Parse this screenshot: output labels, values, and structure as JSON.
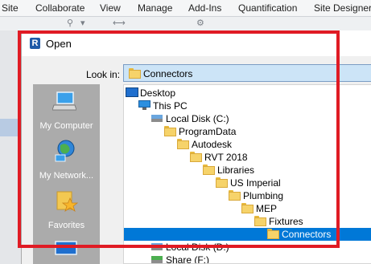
{
  "menubar": {
    "items": [
      "Site",
      "Collaborate",
      "View",
      "Manage",
      "Add-Ins",
      "Quantification",
      "Site Designer"
    ]
  },
  "dialog": {
    "title": "Open",
    "app_icon_letter": "R",
    "look_in_label": "Look in:",
    "look_in_value": "Connectors",
    "places": [
      {
        "label": "My Computer",
        "icon": "computer-icon"
      },
      {
        "label": "My Network...",
        "icon": "network-icon"
      },
      {
        "label": "Favorites",
        "icon": "favorites-icon"
      },
      {
        "label": "",
        "icon": "desktop-icon"
      }
    ],
    "tree": [
      {
        "label": "Desktop",
        "icon": "desktop-icon",
        "level": 0,
        "selected": false
      },
      {
        "label": "This PC",
        "icon": "monitor-icon",
        "level": 1,
        "selected": false
      },
      {
        "label": "Local Disk (C:)",
        "icon": "drive-icon",
        "level": 2,
        "selected": false
      },
      {
        "label": "ProgramData",
        "icon": "folder-icon",
        "level": 3,
        "selected": false
      },
      {
        "label": "Autodesk",
        "icon": "folder-icon",
        "level": 4,
        "selected": false
      },
      {
        "label": "RVT 2018",
        "icon": "folder-icon",
        "level": 5,
        "selected": false
      },
      {
        "label": "Libraries",
        "icon": "folder-icon",
        "level": 6,
        "selected": false
      },
      {
        "label": "US Imperial",
        "icon": "folder-icon",
        "level": 7,
        "selected": false
      },
      {
        "label": "Plumbing",
        "icon": "folder-icon",
        "level": 8,
        "selected": false
      },
      {
        "label": "MEP",
        "icon": "folder-icon",
        "level": 9,
        "selected": false
      },
      {
        "label": "Fixtures",
        "icon": "folder-icon",
        "level": 10,
        "selected": false
      },
      {
        "label": "Connectors",
        "icon": "folder-icon",
        "level": 11,
        "selected": true
      },
      {
        "label": "Local Disk (D:)",
        "icon": "drive-icon",
        "level": 2,
        "selected": false
      },
      {
        "label": "Share (F:)",
        "icon": "network-drive-icon",
        "level": 2,
        "selected": false
      }
    ]
  },
  "colors": {
    "selection": "#0078d7",
    "annotation_red": "#e01b24",
    "places_bg": "#ababab"
  }
}
